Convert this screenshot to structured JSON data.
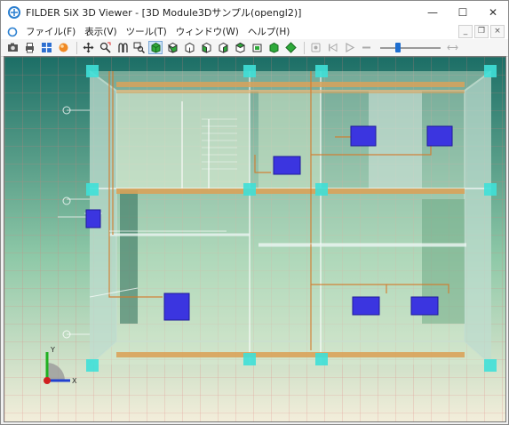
{
  "window": {
    "title": "FILDER SiX 3D Viewer - [3D Module3Dサンプル(opengl2)]",
    "controls": {
      "minimize": "—",
      "maximize": "☐",
      "close": "✕"
    }
  },
  "menu": {
    "items": [
      "ファイル(F)",
      "表示(V)",
      "ツール(T)",
      "ウィンドウ(W)",
      "ヘルプ(H)"
    ],
    "mdi": {
      "minimize": "_",
      "restore": "❐",
      "close": "×"
    }
  },
  "toolbar": {
    "icons": [
      "camera-icon",
      "print-icon",
      "grid-view-icon",
      "sphere-render-icon",
      "move-icon",
      "zoom-region-icon",
      "walk-icon",
      "zoom-window-icon",
      "iso-view-icon",
      "front-view-icon",
      "back-view-icon",
      "left-view-icon",
      "right-view-icon",
      "top-view-icon",
      "bottom-view-icon",
      "cube-view-icon",
      "green-diamond-icon"
    ],
    "playback": [
      "record-icon",
      "step-back-icon",
      "play-icon",
      "stop-icon"
    ],
    "slider_value": 0.3
  },
  "scene": {
    "axis": {
      "x_label": "X",
      "y_label": "Y"
    },
    "colors": {
      "background_top": "#1c6e66",
      "background_bottom": "#f4eedb",
      "grid": "#e07a7a",
      "wall": "#c8ded0",
      "column": "#3fe0d8",
      "beam": "#d9a25a",
      "unit": "#3b35e0",
      "pipe": "#d47a2a"
    }
  }
}
